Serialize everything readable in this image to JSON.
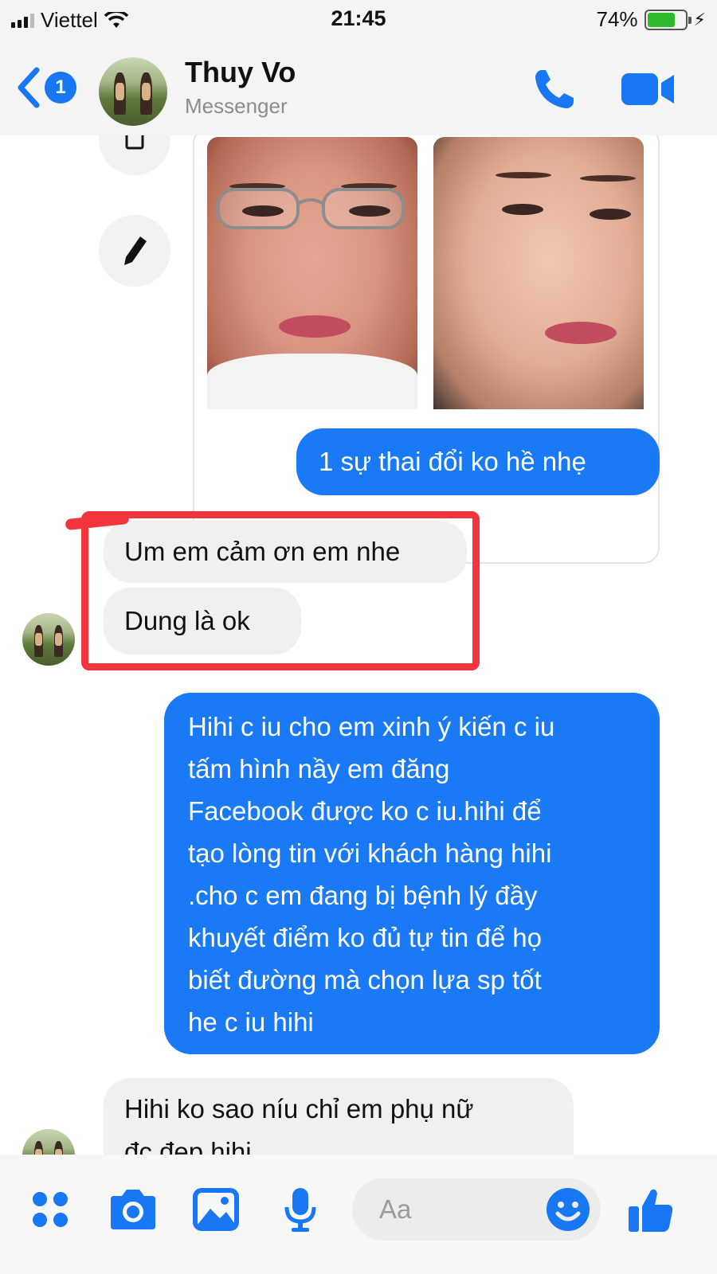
{
  "status_bar": {
    "carrier": "Viettel",
    "time": "21:45",
    "battery_percent": "74%",
    "battery_level": 0.74
  },
  "header": {
    "unread_badge": "1",
    "contact_name": "Thuy Vo",
    "contact_subtitle": "Messenger"
  },
  "messages": [
    {
      "sender": "me",
      "type": "text",
      "text": "1 sự thai đổi ko hề nhẹ"
    },
    {
      "sender": "contact",
      "type": "text",
      "text": "Um em cảm ơn em nhe"
    },
    {
      "sender": "contact",
      "type": "text",
      "text": "Dung là ok"
    },
    {
      "sender": "me",
      "type": "text",
      "lines": [
        "Hihi c iu cho em xinh ý kiến c iu",
        "tấm hình nầy em đăng",
        "Facebook được ko c iu.hihi để",
        "tạo lòng tin với khách hàng hihi",
        ".cho c em đang bị bệnh lý đầy",
        "khuyết điểm ko đủ tự tin để họ",
        "biết đường mà chọn lựa sp tốt",
        "he c iu hihi"
      ]
    },
    {
      "sender": "contact",
      "type": "text",
      "lines": [
        "Hihi ko sao níu chỉ em phụ nữ",
        "đc đẹp hihi"
      ]
    }
  ],
  "composer": {
    "placeholder": "Aa"
  },
  "colors": {
    "accent": "#1877f2",
    "outgoing_bubble": "#1a7af5",
    "incoming_bubble": "#f1f0f0",
    "highlight": "#f2353c"
  },
  "icons": {
    "back": "chevron-left-icon",
    "call": "phone-icon",
    "video": "video-camera-icon",
    "apps": "four-dots-icon",
    "camera": "camera-icon",
    "gallery": "image-icon",
    "mic": "microphone-icon",
    "emoji": "smiley-icon",
    "like": "thumbs-up-icon",
    "side_edit": "pencil-icon"
  }
}
